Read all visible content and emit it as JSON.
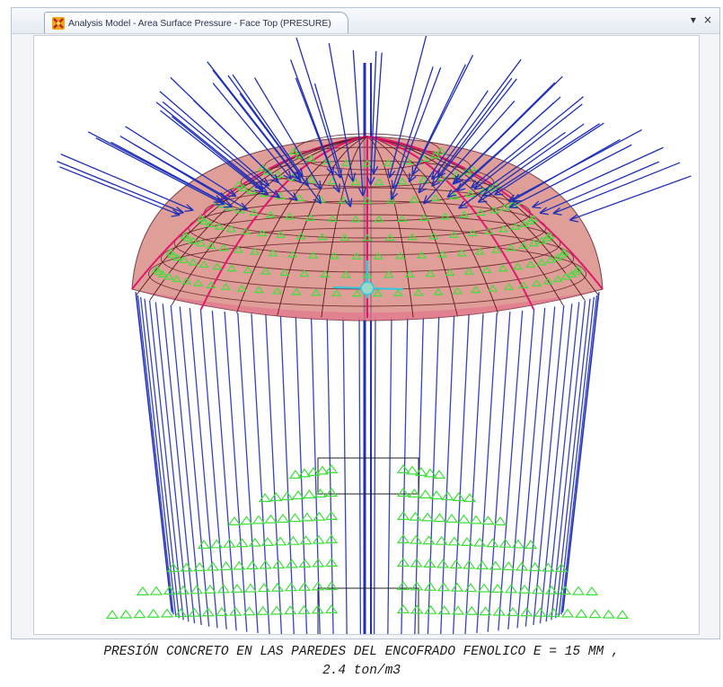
{
  "window": {
    "tab_title": "Analysis Model - Area Surface Pressure - Face Top (PRESURE)",
    "app_icon": "csi-logo-icon",
    "controls": {
      "dropdown_glyph": "▾",
      "close_glyph": "×"
    }
  },
  "caption": {
    "line1": "PRESIÓN CONCRETO EN LAS PAREDES DEL ENCOFRADO FENOLICO E = 15 MM ,",
    "line2": "2.4 ton/m3"
  },
  "colors": {
    "load_arrows": "#1f2fb8",
    "supports": "#3fe03a",
    "dome_fill": "#d88a82",
    "dome_mesh": "#5a1620",
    "dome_ribs": "#e0186c",
    "axes": "#2ec8e0"
  }
}
